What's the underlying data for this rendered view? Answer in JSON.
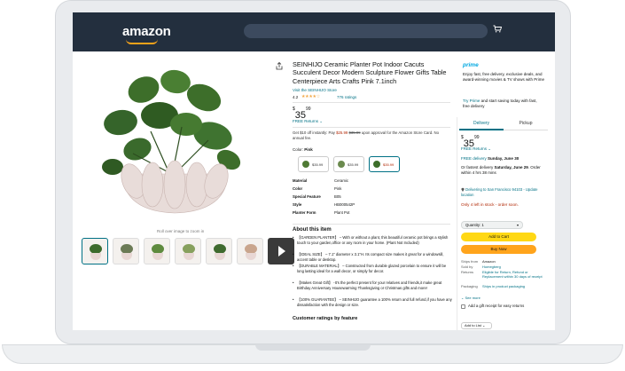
{
  "header": {
    "logo_text": "amazon",
    "cart_icon": "cart-icon",
    "colors": {
      "bar": "#232f3e",
      "search": "#3c4a5e",
      "smile": "#f6a31a"
    }
  },
  "gallery": {
    "zoom_hint": "Roll over image to zoom in",
    "thumb_count": 7,
    "has_video": true
  },
  "product": {
    "title": "SEINHIJO Ceramic Planter Pot Indoor Cacuts Succulent Decor Modern Sculpture Flower Gifts Table Centerpiece Arts Crafts Pink 7.1inch",
    "store_link": "Visit the SEINHIJO Store",
    "rating": "4.2",
    "stars_glyph": "★★★★☆",
    "ratings_count": "776 ratings",
    "price": {
      "symbol": "$",
      "whole": "35",
      "fraction": "99"
    },
    "free_returns": "FREE Returns ⌄",
    "promo": {
      "pre": "Get $10 off instantly: Pay ",
      "new_price": "$25.99",
      "old_price": "$35.99",
      "post": " upon approval for the Amazon Store Card. No annual fee."
    },
    "color_label_prefix": "Color: ",
    "color_value": "Pink",
    "swatches": [
      {
        "price": "$35.99",
        "selected": false
      },
      {
        "price": "$35.99",
        "selected": false
      },
      {
        "price": "$35.99",
        "selected": true
      }
    ],
    "specs": [
      {
        "k": "Material",
        "v": "Ceramic"
      },
      {
        "k": "Color",
        "v": "Pink"
      },
      {
        "k": "Special Feature",
        "v": "B05"
      },
      {
        "k": "Style",
        "v": "HB000542P"
      },
      {
        "k": "Planter Form",
        "v": "Plant Pot"
      }
    ],
    "about_heading": "About this item",
    "bullets": [
      "【GARDEN PLANTER】 – With or without a plant, this beautiful ceramic pot brings a stylish touch to your garden,office or any room in your home. (Plant Not Included)",
      "【IDEAL SIZE】 – 7.1\" diameter x 3.1\"H. Its compact size makes it great for a windowsill, accent table or desktop.",
      "【DURABLE MATERIAL】 – Constructed from durable glazed porcelain to ensure it will be long lasting ideal for a wall decor, or simply for decor.",
      "【Makes Great Gift】 -It's the perfect present for your relatives and friends,it make great Birthday Anniversary Housewarming Thanksgiving or Christmas gifts and more!",
      "【100% GUARANTEE】 – SEINHIJO guarantee a 100% return and full refund,if you have any dissatisfaction with the design or size."
    ],
    "ratings_feature_heading": "Customer ratings by feature"
  },
  "buybox": {
    "prime_logo": "prime",
    "prime_desc": "Enjoy fast, free delivery, exclusive deals, and award-winning movies & TV shows with Prime",
    "prime_try_link": "Try Prime",
    "prime_try_rest": " and start saving today with fast, free delivery",
    "tab_delivery": "Delivery",
    "tab_pickup": "Pickup",
    "price": {
      "symbol": "$",
      "whole": "35",
      "fraction": "99"
    },
    "free_returns": "FREE Returns ⌄",
    "delivery_pre": "FREE delivery ",
    "delivery_date": "Sunday, June 30",
    "fastest_pre": "Or fastest delivery ",
    "fastest_date": "Saturday, June 29",
    "fastest_post": ". Order within 4 hrs 38 mins",
    "location": "Delivering to San Francisco 94103 - Update location",
    "stock": "Only 4 left in stock - order soon.",
    "quantity": "Quantity: 1",
    "add_to_cart": "Add to Cart",
    "buy_now": "Buy Now",
    "ship_rows": [
      {
        "k": "Ships from",
        "v": "Amazon"
      },
      {
        "k": "Sold by",
        "v": "Homegberg"
      },
      {
        "k": "Returns",
        "v": "Eligible for Return, Refund or Replacement within 30 days of receipt"
      },
      {
        "k": "Packaging",
        "v": "Ships in product packaging"
      }
    ],
    "see_more": "⌄ See more",
    "gift_label": "Add a gift receipt for easy returns",
    "add_to_list": "Add to List ⌄",
    "colors": {
      "add_cart": "#ffd814",
      "buy_now": "#ffa41c",
      "link": "#007185",
      "stock": "#b12704"
    }
  }
}
